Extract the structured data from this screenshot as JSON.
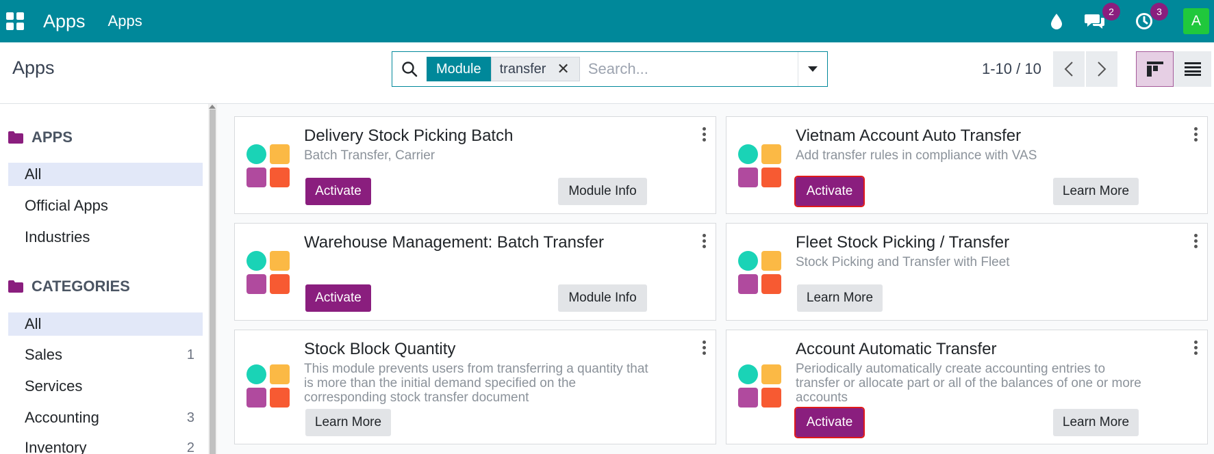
{
  "navbar": {
    "brand": "Apps",
    "menu": "Apps",
    "messages_count": "2",
    "activities_count": "3",
    "avatar_letter": "A"
  },
  "control": {
    "breadcrumb": "Apps",
    "facet_label": "Module",
    "facet_value": "transfer",
    "search_placeholder": "Search...",
    "pager": "1-10 / 10"
  },
  "sidebar": {
    "apps_header": "APPS",
    "apps_items": [
      {
        "label": "All"
      },
      {
        "label": "Official Apps"
      },
      {
        "label": "Industries"
      }
    ],
    "categories_header": "CATEGORIES",
    "category_items": [
      {
        "label": "All",
        "count": ""
      },
      {
        "label": "Sales",
        "count": "1"
      },
      {
        "label": "Services",
        "count": ""
      },
      {
        "label": "Accounting",
        "count": "3"
      },
      {
        "label": "Inventory",
        "count": "2"
      }
    ]
  },
  "cards": [
    {
      "title": "Delivery Stock Picking Batch",
      "summary": "Batch Transfer, Carrier",
      "primary": "Activate",
      "secondary": "Module Info"
    },
    {
      "title": "Vietnam Account Auto Transfer",
      "summary": "Add transfer rules in compliance with VAS",
      "primary": "Activate",
      "secondary": "Learn More"
    },
    {
      "title": "Warehouse Management: Batch Transfer",
      "summary": "",
      "primary": "Activate",
      "secondary": "Module Info"
    },
    {
      "title": "Fleet Stock Picking / Transfer",
      "summary": "Stock Picking and Transfer with Fleet",
      "primary": "",
      "secondary": "Learn More"
    },
    {
      "title": "Stock Block Quantity",
      "summary": "This module prevents users from transferring a quantity that is more than the initial demand specified on the corresponding stock transfer document",
      "primary": "",
      "secondary": "Learn More"
    },
    {
      "title": "Account Automatic Transfer",
      "summary": "Periodically automatically create accounting entries to transfer or allocate part or all of the balances of one or more accounts",
      "primary": "Activate",
      "secondary": "Learn More"
    }
  ],
  "colors": {
    "navbar": "#00889a",
    "primary_button": "#8a1e7e",
    "highlight_outline": "#e01a1a"
  }
}
